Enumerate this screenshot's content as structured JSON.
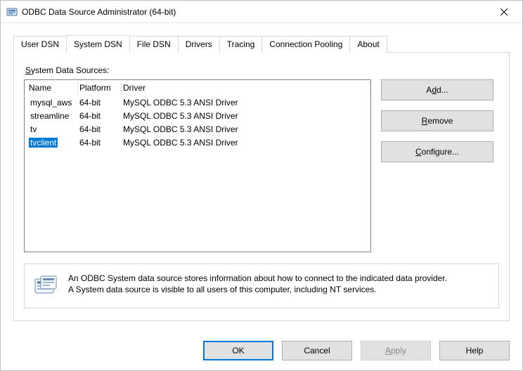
{
  "window": {
    "title": "ODBC Data Source Administrator (64-bit)"
  },
  "tabs": [
    {
      "label": "User DSN"
    },
    {
      "label": "System DSN"
    },
    {
      "label": "File DSN"
    },
    {
      "label": "Drivers"
    },
    {
      "label": "Tracing"
    },
    {
      "label": "Connection Pooling"
    },
    {
      "label": "About"
    }
  ],
  "section": {
    "label_prefix": "S",
    "label_rest": "ystem Data Sources:"
  },
  "headers": {
    "name": "Name",
    "platform": "Platform",
    "driver": "Driver"
  },
  "rows": [
    {
      "name": "mysql_aws",
      "platform": "64-bit",
      "driver": "MySQL ODBC 5.3 ANSI Driver",
      "selected": false
    },
    {
      "name": "streamline",
      "platform": "64-bit",
      "driver": "MySQL ODBC 5.3 ANSI Driver",
      "selected": false
    },
    {
      "name": "tv",
      "platform": "64-bit",
      "driver": "MySQL ODBC 5.3 ANSI Driver",
      "selected": false
    },
    {
      "name": "tvclient",
      "platform": "64-bit",
      "driver": "MySQL ODBC 5.3 ANSI Driver",
      "selected": true
    }
  ],
  "buttons": {
    "add_prefix": "A",
    "add_underlined": "d",
    "add_suffix": "d...",
    "remove_prefix": "",
    "remove_underlined": "R",
    "remove_suffix": "emove",
    "configure_prefix": "",
    "configure_underlined": "C",
    "configure_suffix": "onfigure..."
  },
  "info": {
    "line1": "An ODBC System data source stores information about how to connect to the indicated data provider.",
    "line2": "A System data source is visible to all users of this computer, including NT services."
  },
  "footer": {
    "ok": "OK",
    "cancel": "Cancel",
    "apply_prefix": "",
    "apply_underlined": "A",
    "apply_suffix": "pply",
    "help": "Help"
  }
}
